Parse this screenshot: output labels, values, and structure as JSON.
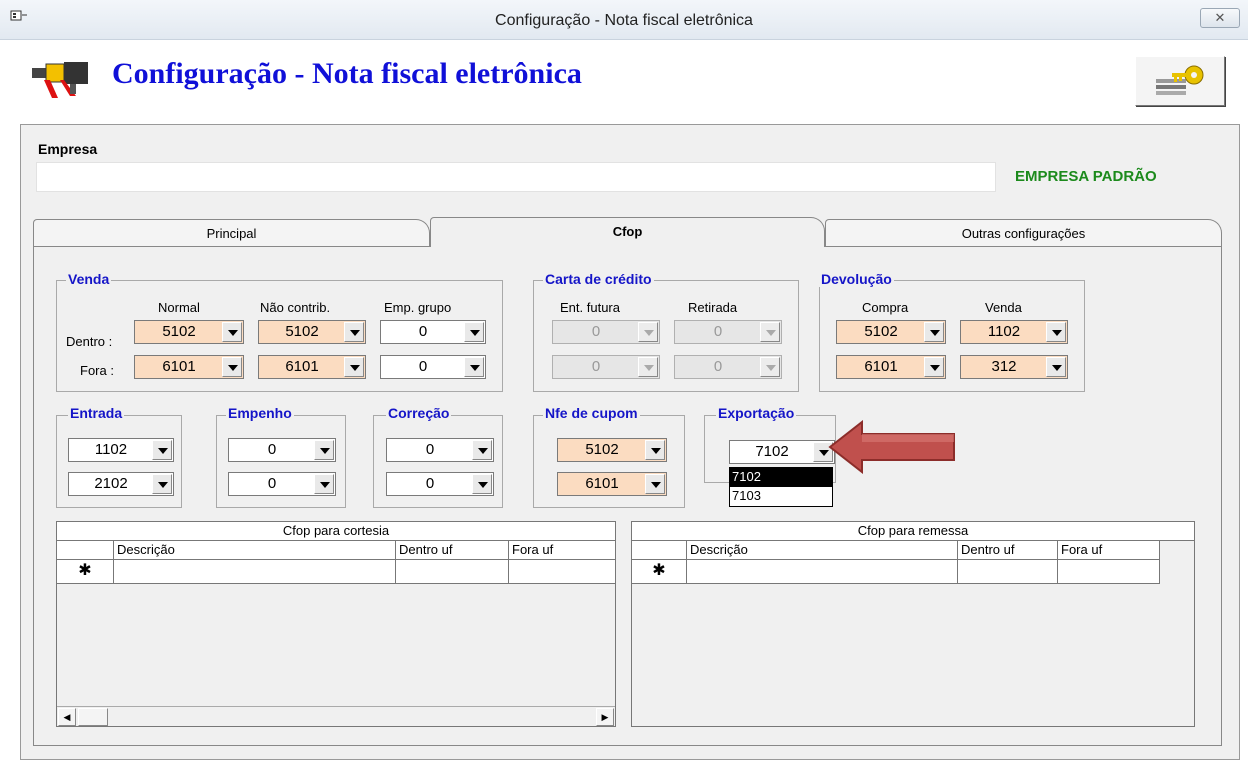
{
  "window": {
    "title": "Configuração - Nota fiscal eletrônica",
    "close_glyph": "✕"
  },
  "header": {
    "title": "Configuração - Nota fiscal eletrônica"
  },
  "empresa": {
    "label": "Empresa",
    "value": "",
    "status": "EMPRESA PADRÃO"
  },
  "tabs": [
    {
      "label": "Principal",
      "active": false
    },
    {
      "label": "Cfop",
      "active": true
    },
    {
      "label": "Outras configurações",
      "active": false
    }
  ],
  "venda": {
    "title": "Venda",
    "cols": [
      "Normal",
      "Não contrib.",
      "Emp. grupo"
    ],
    "rows": [
      {
        "label": "Dentro :",
        "values": [
          "5102",
          "5102",
          "0"
        ]
      },
      {
        "label": "Fora :",
        "values": [
          "6101",
          "6101",
          "0"
        ]
      }
    ]
  },
  "carta": {
    "title": "Carta de crédito",
    "cols": [
      "Ent. futura",
      "Retirada"
    ],
    "rows": [
      [
        "0",
        "0"
      ],
      [
        "0",
        "0"
      ]
    ]
  },
  "devolucao": {
    "title": "Devolução",
    "cols": [
      "Compra",
      "Venda"
    ],
    "rows": [
      [
        "5102",
        "1102"
      ],
      [
        "6101",
        "312"
      ]
    ]
  },
  "entrada": {
    "title": "Entrada",
    "values": [
      "1102",
      "2102"
    ]
  },
  "empenho": {
    "title": "Empenho",
    "values": [
      "0",
      "0"
    ]
  },
  "correcao": {
    "title": "Correção",
    "values": [
      "0",
      "0"
    ]
  },
  "nfe_cupom": {
    "title": "Nfe de cupom",
    "values": [
      "5102",
      "6101"
    ]
  },
  "exportacao": {
    "title": "Exportação",
    "value": "7102",
    "options": [
      "7102",
      "7103"
    ],
    "selected": "7102"
  },
  "cortesia": {
    "title": "Cfop para cortesia",
    "columns": [
      "Descrição",
      "Dentro uf",
      "Fora uf"
    ],
    "new_row_marker": "✱"
  },
  "remessa": {
    "title": "Cfop para remessa",
    "columns": [
      "Descrição",
      "Dentro uf",
      "Fora uf"
    ],
    "new_row_marker": "✱"
  },
  "colors": {
    "title_blue": "#1010d8",
    "group_blue": "#1515c8",
    "status_green": "#1c8a1c",
    "peach": "#fbdcc1",
    "arrow": "#c0504d"
  }
}
